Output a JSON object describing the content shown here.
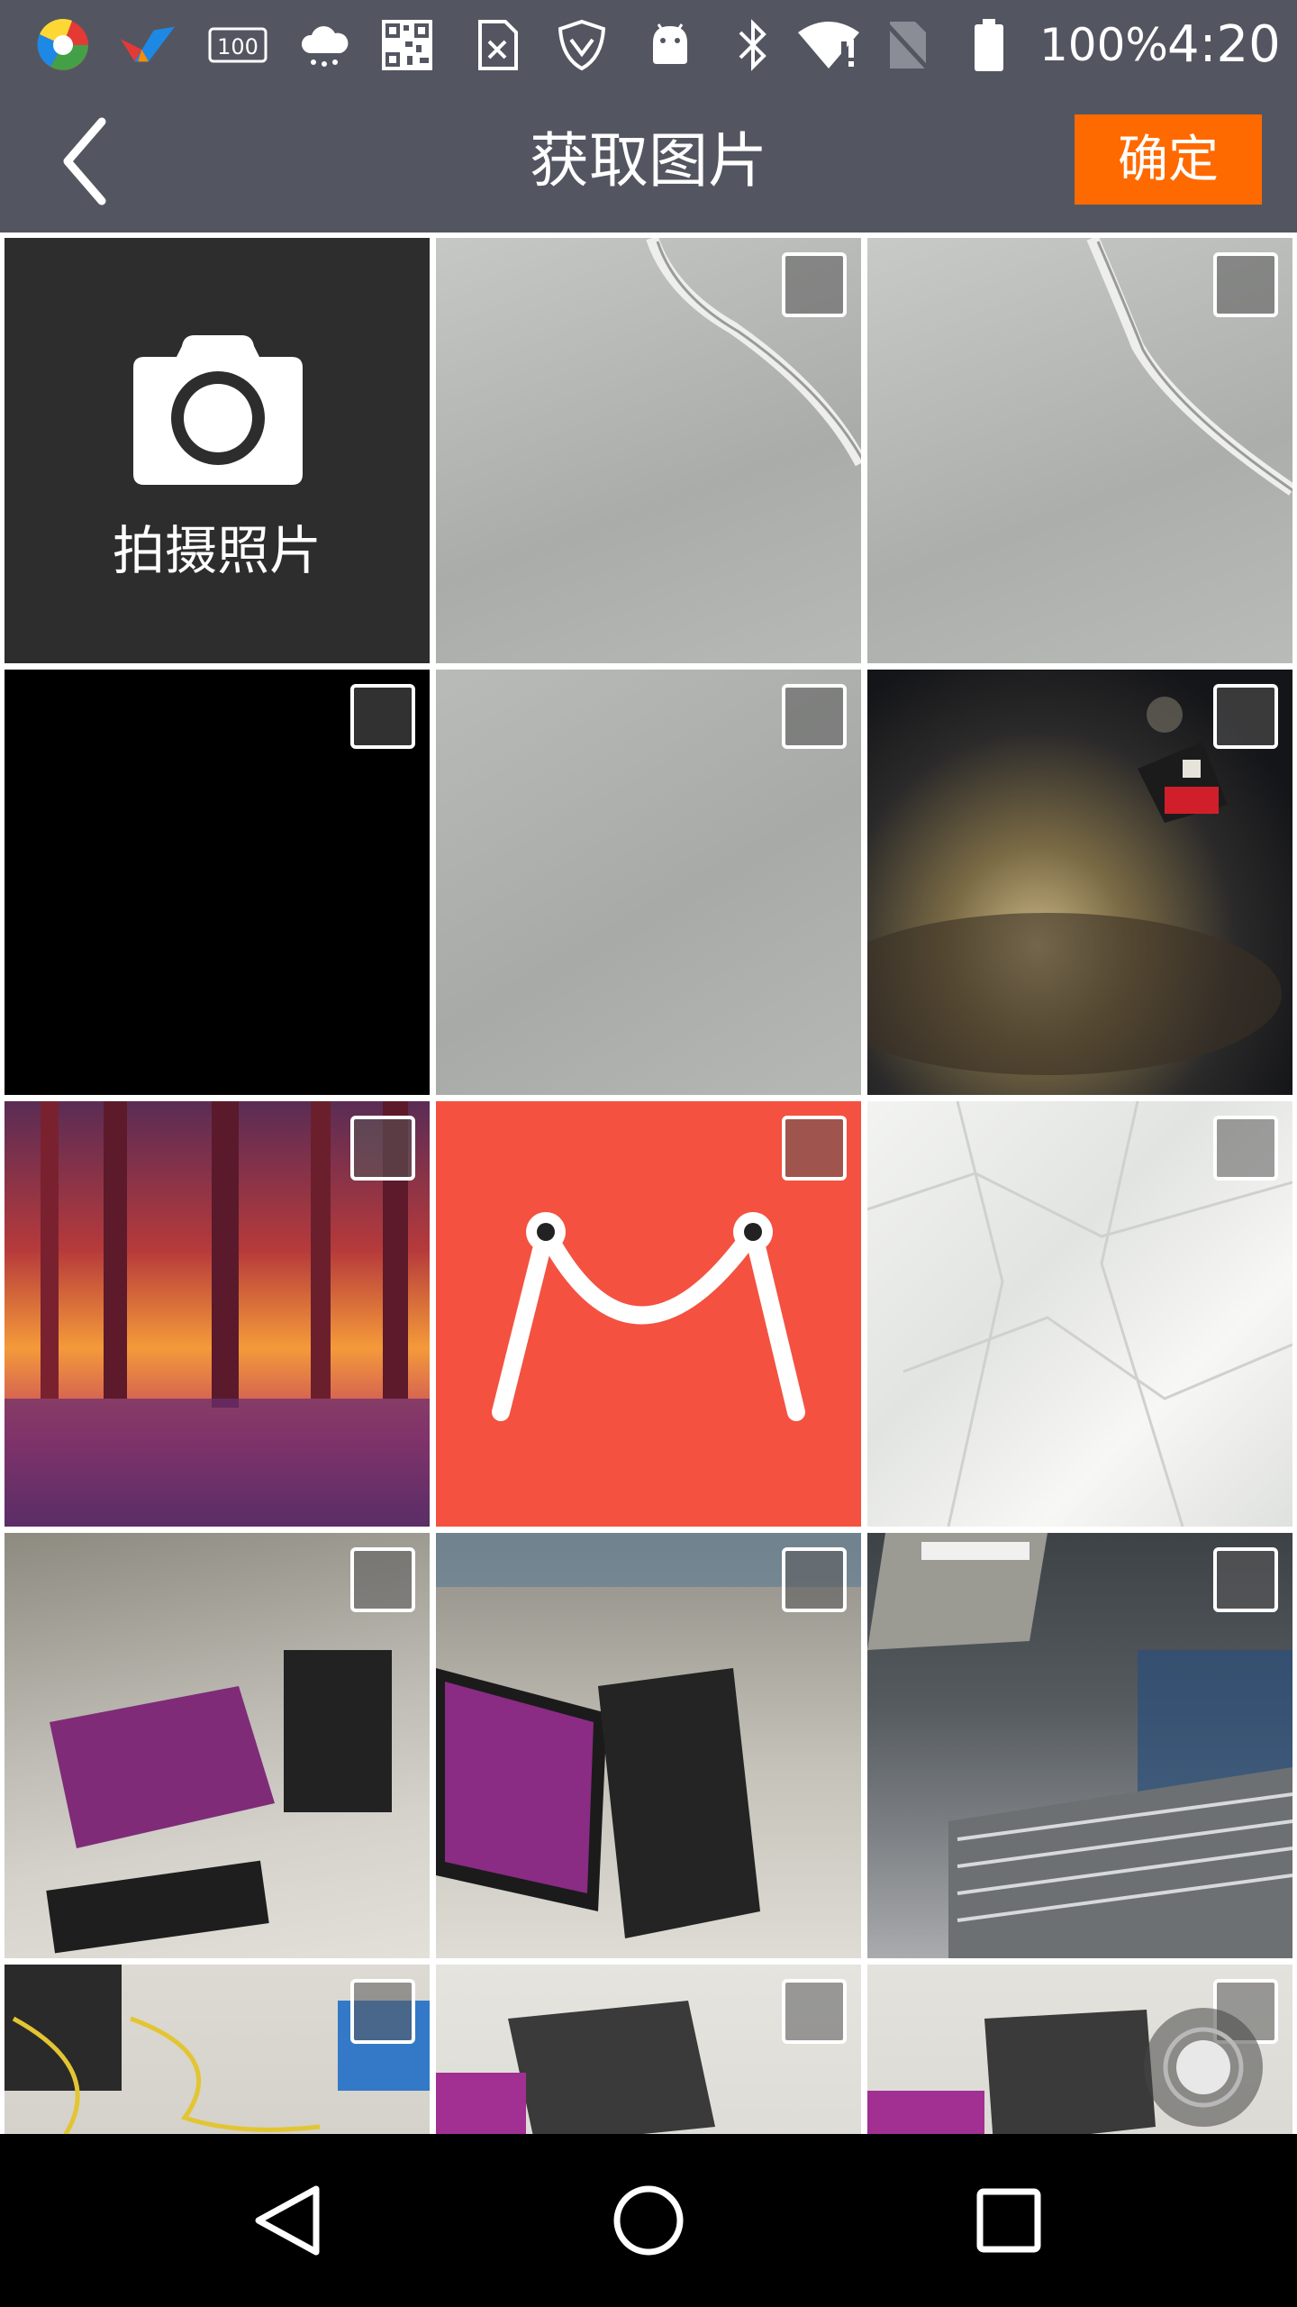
{
  "status_bar": {
    "battery_text": "100%",
    "time": "4:20",
    "notification_badge": "100",
    "icons": [
      "chrome-like-icon",
      "app-v-icon",
      "badge-100-icon",
      "cloud-icon",
      "qr-code-icon",
      "sim-x-icon",
      "vpn-shield-icon",
      "android-icon",
      "bluetooth-icon",
      "wifi-alert-icon",
      "no-sim-icon",
      "battery-icon"
    ]
  },
  "app_bar": {
    "title": "获取图片",
    "confirm_label": "确定",
    "accent_color": "#ff6a00",
    "background_color": "#535661"
  },
  "camera_tile": {
    "label": "拍摄照片",
    "icon": "camera-icon"
  },
  "photos": [
    {
      "name": "photo-cable-1"
    },
    {
      "name": "photo-cable-2"
    },
    {
      "name": "photo-black"
    },
    {
      "name": "photo-gray-surface"
    },
    {
      "name": "photo-turntable"
    },
    {
      "name": "photo-forest"
    },
    {
      "name": "photo-smile-logo"
    },
    {
      "name": "photo-crumpled-paper"
    },
    {
      "name": "photo-desk-blur"
    },
    {
      "name": "photo-monitor-desk"
    },
    {
      "name": "photo-office-hall"
    },
    {
      "name": "photo-cables-floor"
    },
    {
      "name": "photo-pc-tower-1"
    },
    {
      "name": "photo-pc-tower-2"
    }
  ],
  "nav_bar": {
    "icons": [
      "back-triangle-icon",
      "home-circle-icon",
      "recents-square-icon"
    ]
  }
}
